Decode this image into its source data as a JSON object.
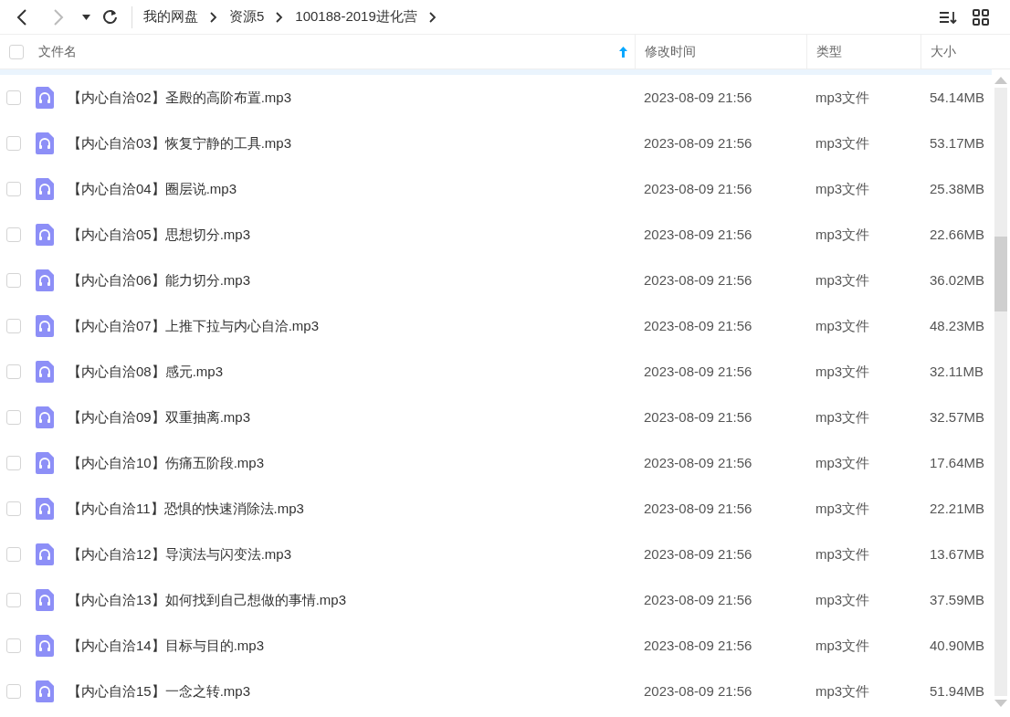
{
  "breadcrumb": [
    "我的网盘",
    "资源5",
    "100188-2019进化营"
  ],
  "columns": [
    {
      "label": "文件名",
      "sorted_ascending": true
    },
    {
      "label": "修改时间",
      "sorted_ascending": false
    },
    {
      "label": "类型",
      "sorted_ascending": false
    },
    {
      "label": "大小",
      "sorted_ascending": false
    }
  ],
  "select_all": {
    "checked": false
  },
  "rows": [
    {
      "name": "【内心自洽02】圣殿的高阶布置.mp3",
      "modified": "2023-08-09 21:56",
      "type": "mp3文件",
      "size": "54.14MB",
      "checked": false
    },
    {
      "name": "【内心自洽03】恢复宁静的工具.mp3",
      "modified": "2023-08-09 21:56",
      "type": "mp3文件",
      "size": "53.17MB",
      "checked": false
    },
    {
      "name": "【内心自洽04】圈层说.mp3",
      "modified": "2023-08-09 21:56",
      "type": "mp3文件",
      "size": "25.38MB",
      "checked": false
    },
    {
      "name": "【内心自洽05】思想切分.mp3",
      "modified": "2023-08-09 21:56",
      "type": "mp3文件",
      "size": "22.66MB",
      "checked": false
    },
    {
      "name": "【内心自洽06】能力切分.mp3",
      "modified": "2023-08-09 21:56",
      "type": "mp3文件",
      "size": "36.02MB",
      "checked": false
    },
    {
      "name": "【内心自洽07】上推下拉与内心自洽.mp3",
      "modified": "2023-08-09 21:56",
      "type": "mp3文件",
      "size": "48.23MB",
      "checked": false
    },
    {
      "name": "【内心自洽08】感元.mp3",
      "modified": "2023-08-09 21:56",
      "type": "mp3文件",
      "size": "32.11MB",
      "checked": false
    },
    {
      "name": "【内心自洽09】双重抽离.mp3",
      "modified": "2023-08-09 21:56",
      "type": "mp3文件",
      "size": "32.57MB",
      "checked": false
    },
    {
      "name": "【内心自洽10】伤痛五阶段.mp3",
      "modified": "2023-08-09 21:56",
      "type": "mp3文件",
      "size": "17.64MB",
      "checked": false
    },
    {
      "name": "【内心自洽11】恐惧的快速消除法.mp3",
      "modified": "2023-08-09 21:56",
      "type": "mp3文件",
      "size": "22.21MB",
      "checked": false
    },
    {
      "name": "【内心自洽12】导演法与闪变法.mp3",
      "modified": "2023-08-09 21:56",
      "type": "mp3文件",
      "size": "13.67MB",
      "checked": false
    },
    {
      "name": "【内心自洽13】如何找到自己想做的事情.mp3",
      "modified": "2023-08-09 21:56",
      "type": "mp3文件",
      "size": "37.59MB",
      "checked": false
    },
    {
      "name": "【内心自洽14】目标与目的.mp3",
      "modified": "2023-08-09 21:56",
      "type": "mp3文件",
      "size": "40.90MB",
      "checked": false
    },
    {
      "name": "【内心自洽15】一念之转.mp3",
      "modified": "2023-08-09 21:56",
      "type": "mp3文件",
      "size": "51.94MB",
      "checked": false
    }
  ]
}
